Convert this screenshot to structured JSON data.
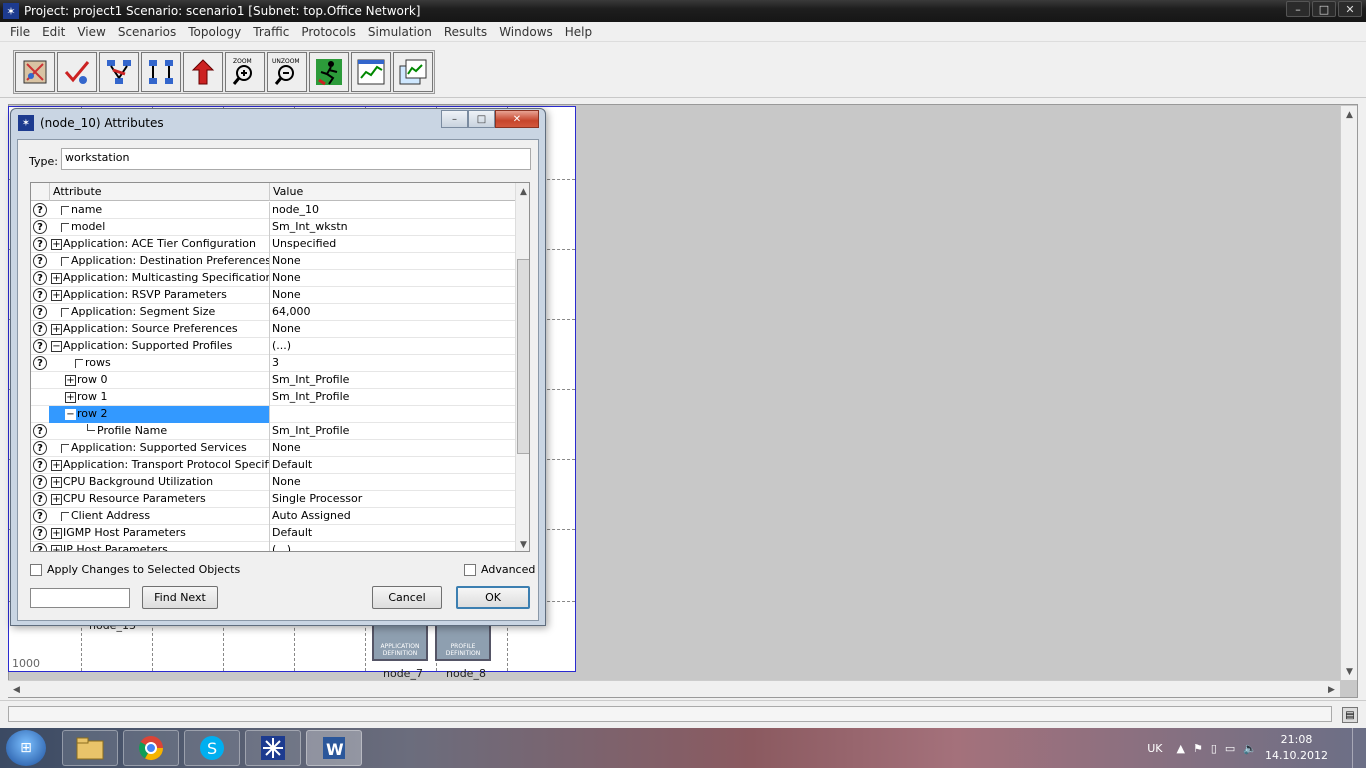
{
  "window": {
    "title": "Project: project1 Scenario: scenario1  [Subnet: top.Office Network]",
    "minimize": "–",
    "maximize": "□",
    "close": "✕"
  },
  "menu": [
    "File",
    "Edit",
    "View",
    "Scenarios",
    "Topology",
    "Traffic",
    "Protocols",
    "Simulation",
    "Results",
    "Windows",
    "Help"
  ],
  "toolbar": {
    "buttons": [
      "open-palette",
      "check-links",
      "fail-link",
      "recover-link",
      "return-to-parent",
      "zoom",
      "unzoom",
      "configure-run",
      "view-results",
      "hide-graphs"
    ],
    "zoom_label": "ZOOM",
    "unzoom_label": "UNZOOM"
  },
  "canvas": {
    "coord_label": "1000",
    "nodes": [
      {
        "name": "node_7",
        "caption": "APPLICATION DEFINITION"
      },
      {
        "name": "node_8",
        "caption": "PROFILE DEFINITION"
      },
      {
        "name": "node_13"
      }
    ]
  },
  "dialog": {
    "title": "(node_10) Attributes",
    "type_label": "Type:",
    "type_value": "workstation",
    "header_attribute": "Attribute",
    "header_value": "Value",
    "rows": [
      {
        "attr": "name",
        "value": "node_10"
      },
      {
        "attr": "model",
        "value": "Sm_Int_wkstn"
      },
      {
        "attr": "Application: ACE Tier Configuration",
        "value": "Unspecified"
      },
      {
        "attr": "Application: Destination Preferences",
        "value": "None"
      },
      {
        "attr": "Application: Multicasting Specification",
        "value": "None"
      },
      {
        "attr": "Application: RSVP Parameters",
        "value": "None"
      },
      {
        "attr": "Application: Segment Size",
        "value": "64,000"
      },
      {
        "attr": "Application: Source Preferences",
        "value": "None"
      },
      {
        "attr": "Application: Supported Profiles",
        "value": "(...)"
      },
      {
        "attr": "rows",
        "value": "3"
      },
      {
        "attr": "row 0",
        "value": "Sm_Int_Profile"
      },
      {
        "attr": "row 1",
        "value": "Sm_Int_Profile"
      },
      {
        "attr": "row 2",
        "value": ""
      },
      {
        "attr": "Profile Name",
        "value": "Sm_Int_Profile"
      },
      {
        "attr": "Application: Supported Services",
        "value": "None"
      },
      {
        "attr": "Application: Transport Protocol Specifica...",
        "value": "Default"
      },
      {
        "attr": "CPU Background Utilization",
        "value": "None"
      },
      {
        "attr": "CPU Resource Parameters",
        "value": "Single Processor"
      },
      {
        "attr": "Client Address",
        "value": "Auto Assigned"
      },
      {
        "attr": "IGMP Host Parameters",
        "value": "Default"
      },
      {
        "attr": "IP Host Parameters",
        "value": "(...)"
      }
    ],
    "apply_label": "Apply Changes to Selected Objects",
    "advanced_label": "Advanced",
    "find_next_label": "Find Next",
    "cancel_label": "Cancel",
    "ok_label": "OK"
  },
  "taskbar": {
    "apps": [
      "windows-explorer",
      "chrome",
      "skype",
      "opnet",
      "word"
    ],
    "lang": "UK",
    "time": "21:08",
    "date": "14.10.2012"
  }
}
